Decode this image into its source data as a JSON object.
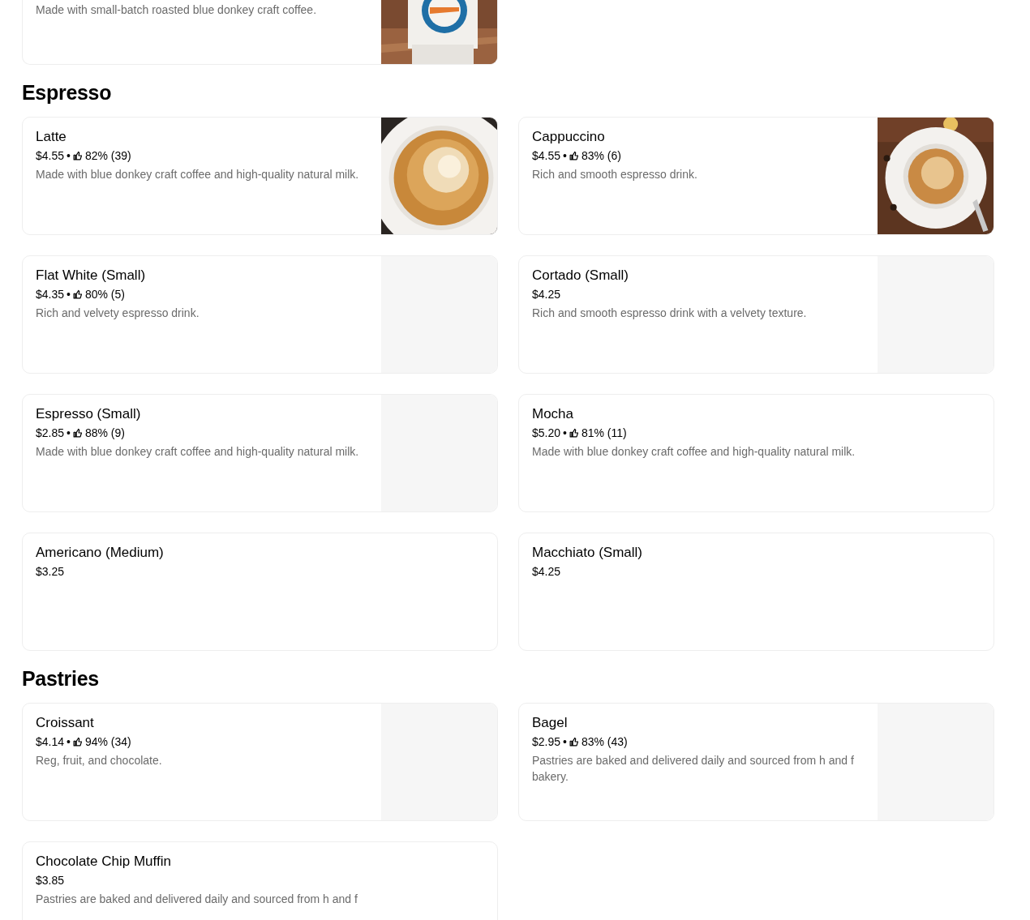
{
  "sections": [
    {
      "items": [
        {
          "description": "Made with small-batch roasted blue donkey craft coffee."
        }
      ]
    },
    {
      "heading": "Espresso",
      "items": [
        {
          "name": "Latte",
          "price": "$4.55",
          "rating": {
            "separator": "•",
            "percent": "82%",
            "count": "(39)"
          },
          "description": "Made with blue donkey craft coffee and high-quality natural milk."
        },
        {
          "name": "Cappuccino",
          "price": "$4.55",
          "rating": {
            "separator": "•",
            "percent": "83%",
            "count": "(6)"
          },
          "description": "Rich and smooth espresso drink."
        },
        {
          "name": "Flat White (Small)",
          "price": "$4.35",
          "rating": {
            "separator": "•",
            "percent": "80%",
            "count": "(5)"
          },
          "description": "Rich and velvety espresso drink.",
          "image": {
            "kind": "placeholder"
          }
        },
        {
          "name": "Cortado (Small)",
          "price": "$4.25",
          "description": "Rich and smooth espresso drink with a velvety texture.",
          "image": {
            "kind": "placeholder"
          }
        },
        {
          "name": "Espresso (Small)",
          "price": "$2.85",
          "rating": {
            "separator": "•",
            "percent": "88%",
            "count": "(9)"
          },
          "description": "Made with blue donkey craft coffee and high-quality natural milk.",
          "image": {
            "kind": "placeholder"
          }
        },
        {
          "name": "Mocha",
          "price": "$5.20",
          "rating": {
            "separator": "•",
            "percent": "81%",
            "count": "(11)"
          },
          "description": "Made with blue donkey craft coffee and high-quality natural milk."
        },
        {
          "name": "Americano (Medium)",
          "price": "$3.25"
        },
        {
          "name": "Macchiato (Small)",
          "price": "$4.25"
        }
      ]
    },
    {
      "heading": "Pastries",
      "items": [
        {
          "name": "Croissant",
          "price": "$4.14",
          "rating": {
            "separator": "•",
            "percent": "94%",
            "count": "(34)"
          },
          "description": "Reg, fruit, and chocolate.",
          "image": {
            "kind": "placeholder"
          }
        },
        {
          "name": "Bagel",
          "price": "$2.95",
          "rating": {
            "separator": "•",
            "percent": "83%",
            "count": "(43)"
          },
          "description": "Pastries are baked and delivered daily and sourced from h and f bakery.",
          "image": {
            "kind": "placeholder"
          }
        },
        {
          "name": "Chocolate Chip Muffin",
          "price": "$3.85",
          "description": "Pastries are baked and delivered daily and sourced from h and f"
        }
      ]
    }
  ]
}
